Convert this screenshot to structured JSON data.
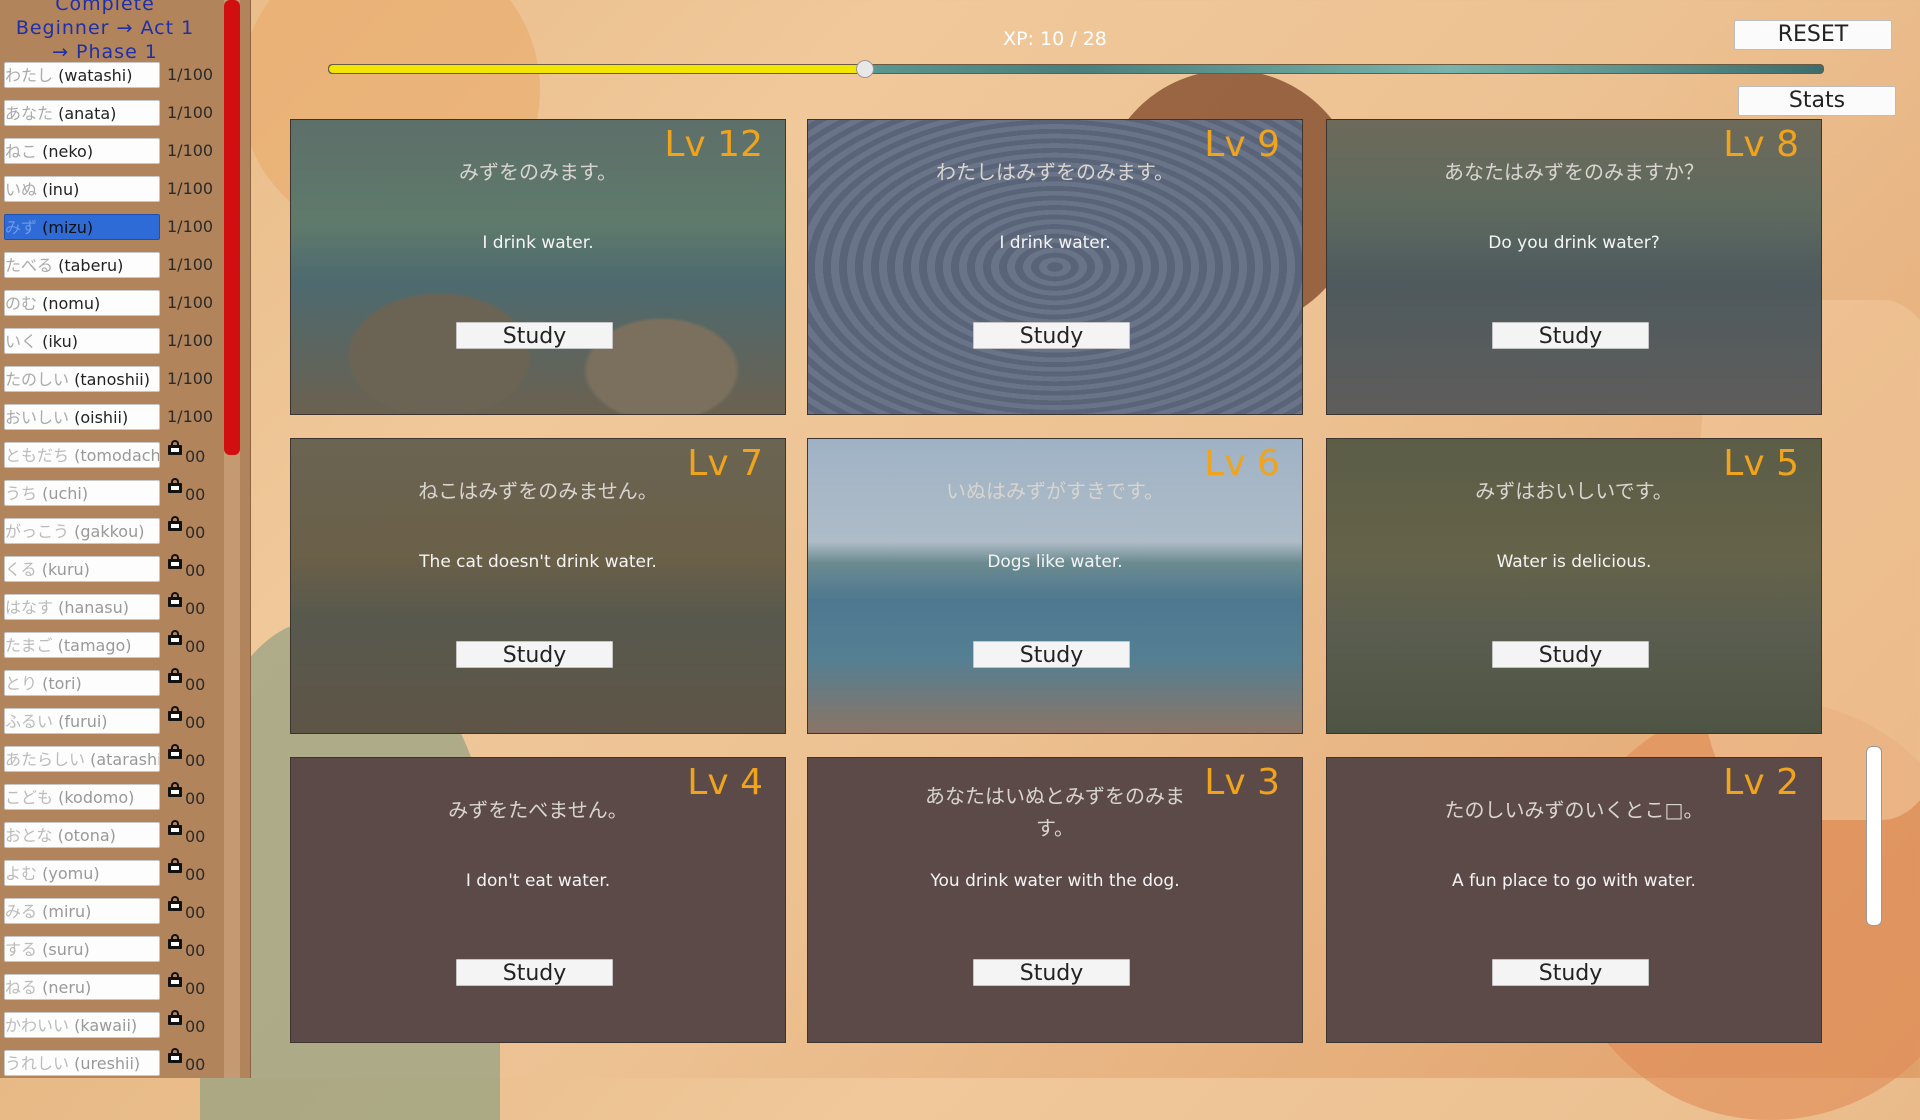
{
  "sidebar": {
    "title_lines": [
      "Complete",
      "Beginner → Act 1",
      "→ Phase 1"
    ],
    "words": [
      {
        "jp": "わたし",
        "romaji": "(watashi)",
        "count": "1/100",
        "locked": false,
        "selected": false
      },
      {
        "jp": "あなた",
        "romaji": "(anata)",
        "count": "1/100",
        "locked": false,
        "selected": false
      },
      {
        "jp": "ねこ",
        "romaji": "(neko)",
        "count": "1/100",
        "locked": false,
        "selected": false
      },
      {
        "jp": "いぬ",
        "romaji": "(inu)",
        "count": "1/100",
        "locked": false,
        "selected": false
      },
      {
        "jp": "みず",
        "romaji": "(mizu)",
        "count": "1/100",
        "locked": false,
        "selected": true
      },
      {
        "jp": "たべる",
        "romaji": "(taberu)",
        "count": "1/100",
        "locked": false,
        "selected": false
      },
      {
        "jp": "のむ",
        "romaji": "(nomu)",
        "count": "1/100",
        "locked": false,
        "selected": false
      },
      {
        "jp": "いく",
        "romaji": "(iku)",
        "count": "1/100",
        "locked": false,
        "selected": false
      },
      {
        "jp": "たのしい",
        "romaji": "(tanoshii)",
        "count": "1/100",
        "locked": false,
        "selected": false
      },
      {
        "jp": "おいしい",
        "romaji": "(oishii)",
        "count": "1/100",
        "locked": false,
        "selected": false
      },
      {
        "jp": "ともだち",
        "romaji": "(tomodachi)",
        "count": "00",
        "locked": true,
        "selected": false
      },
      {
        "jp": "うち",
        "romaji": "(uchi)",
        "count": "00",
        "locked": true,
        "selected": false
      },
      {
        "jp": "がっこう",
        "romaji": "(gakkou)",
        "count": "00",
        "locked": true,
        "selected": false
      },
      {
        "jp": "くる",
        "romaji": "(kuru)",
        "count": "00",
        "locked": true,
        "selected": false
      },
      {
        "jp": "はなす",
        "romaji": "(hanasu)",
        "count": "00",
        "locked": true,
        "selected": false
      },
      {
        "jp": "たまご",
        "romaji": "(tamago)",
        "count": "00",
        "locked": true,
        "selected": false
      },
      {
        "jp": "とり",
        "romaji": "(tori)",
        "count": "00",
        "locked": true,
        "selected": false
      },
      {
        "jp": "ふるい",
        "romaji": "(furui)",
        "count": "00",
        "locked": true,
        "selected": false
      },
      {
        "jp": "あたらしい",
        "romaji": "(atarashii)",
        "count": "00",
        "locked": true,
        "selected": false
      },
      {
        "jp": "こども",
        "romaji": "(kodomo)",
        "count": "00",
        "locked": true,
        "selected": false
      },
      {
        "jp": "おとな",
        "romaji": "(otona)",
        "count": "00",
        "locked": true,
        "selected": false
      },
      {
        "jp": "よむ",
        "romaji": "(yomu)",
        "count": "00",
        "locked": true,
        "selected": false
      },
      {
        "jp": "みる",
        "romaji": "(miru)",
        "count": "00",
        "locked": true,
        "selected": false
      },
      {
        "jp": "する",
        "romaji": "(suru)",
        "count": "00",
        "locked": true,
        "selected": false
      },
      {
        "jp": "ねる",
        "romaji": "(neru)",
        "count": "00",
        "locked": true,
        "selected": false
      },
      {
        "jp": "かわいい",
        "romaji": "(kawaii)",
        "count": "00",
        "locked": true,
        "selected": false
      },
      {
        "jp": "うれしい",
        "romaji": "(ureshii)",
        "count": "00",
        "locked": true,
        "selected": false
      }
    ]
  },
  "header": {
    "xp_label": "XP: 10 / 28",
    "xp_current": 10,
    "xp_total": 28,
    "reset_label": "RESET",
    "stats_label": "Stats"
  },
  "colors": {
    "accent_level": "#f0a31c",
    "xp_fill": "#f2e500",
    "sidebar_scroll_thumb": "#d10f10",
    "selected_word": "#2e6bd6"
  },
  "cards": [
    {
      "level": "Lv 12",
      "jp": "みずをのみます。",
      "en": "I drink water.",
      "study": "Study",
      "scene": "river-rocks"
    },
    {
      "level": "Lv 9",
      "jp": "わたしはみずをのみます。",
      "en": "I drink water.",
      "study": "Study",
      "scene": "water-ripples"
    },
    {
      "level": "Lv 8",
      "jp": "あなたはみずをのみますか？",
      "en": "Do you drink water?",
      "study": "Study",
      "scene": "lake-forest"
    },
    {
      "level": "Lv 7",
      "jp": "ねこはみずをのみません。",
      "en": "The cat doesn't drink water.",
      "study": "Study",
      "scene": "forest-stream"
    },
    {
      "level": "Lv 6",
      "jp": "いぬはみずがすきです。",
      "en": "Dogs like water.",
      "study": "Study",
      "scene": "sea-shore"
    },
    {
      "level": "Lv 5",
      "jp": "みずはおいしいです。",
      "en": "Water is delicious.",
      "study": "Study",
      "scene": "pond-lilies"
    },
    {
      "level": "Lv 4",
      "jp": "みずをたべません。",
      "en": "I don't eat water.",
      "study": "Study",
      "scene": "plain"
    },
    {
      "level": "Lv 3",
      "jp": "あなたはいぬとみずをのみま\nす。",
      "en": "You drink water with the dog.",
      "study": "Study",
      "scene": "plain"
    },
    {
      "level": "Lv 2",
      "jp": "たのしいみずのいくとこ□。",
      "en": "A fun place to go with water.",
      "study": "Study",
      "scene": "plain"
    }
  ]
}
